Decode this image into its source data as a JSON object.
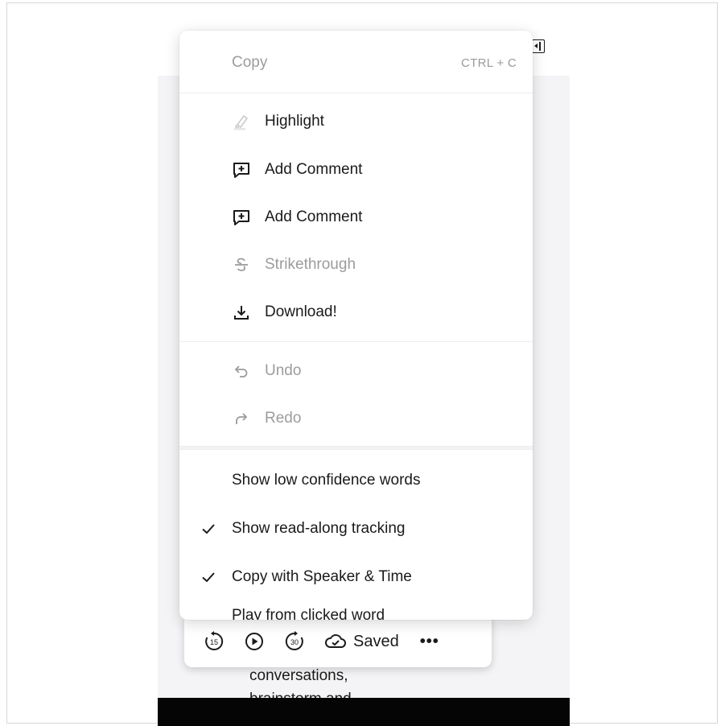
{
  "context_menu": {
    "copy": {
      "label": "Copy",
      "shortcut": "CTRL + C",
      "icon": "none"
    },
    "items": [
      {
        "label": "Highlight",
        "icon": "highlighter-icon",
        "disabled": false
      },
      {
        "label": "Add Comment",
        "icon": "add-comment-icon",
        "disabled": false
      },
      {
        "label": "Add Comment",
        "icon": "add-comment-icon",
        "disabled": false
      },
      {
        "label": "Strikethrough",
        "icon": "strikethrough-icon",
        "disabled": true
      },
      {
        "label": "Download!",
        "icon": "download-icon",
        "disabled": false
      }
    ],
    "history": [
      {
        "label": "Undo",
        "icon": "undo-icon",
        "disabled": true
      },
      {
        "label": "Redo",
        "icon": "redo-icon",
        "disabled": true
      }
    ],
    "toggles": [
      {
        "label": "Show low confidence words",
        "checked": false
      },
      {
        "label": "Show read-along tracking",
        "checked": true
      },
      {
        "label": "Copy with Speaker & Time",
        "checked": true
      }
    ],
    "partial_item": "Play from clicked word"
  },
  "player": {
    "rewind_label": "15",
    "forward_label": "30",
    "play_icon": "play-icon",
    "saved_label": "Saved",
    "more_label": "•••"
  },
  "transcript": {
    "line1": "conversations,",
    "line2": "brainstorm and"
  },
  "colors": {
    "disabled_text": "#9c9c9c",
    "app_background": "#f4f4f6",
    "bottom_bar": "#050505"
  }
}
